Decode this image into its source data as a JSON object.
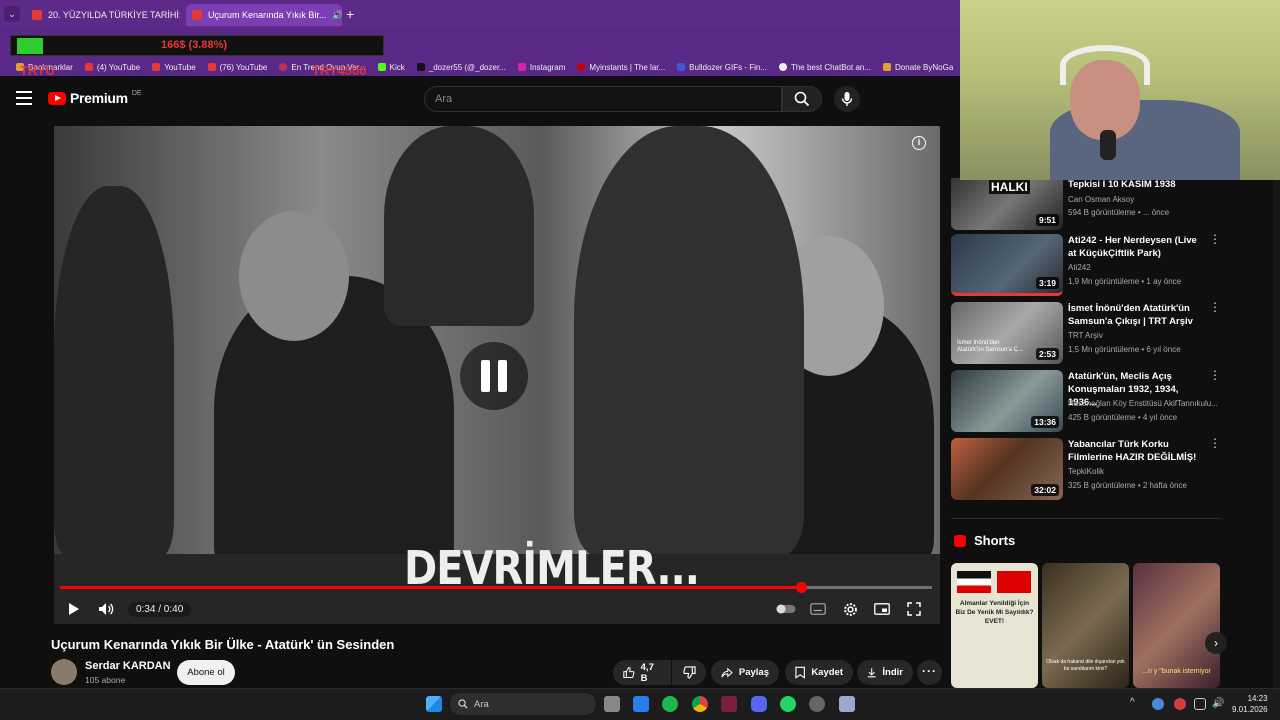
{
  "browser": {
    "tabs": [
      {
        "label": "20. YÜZYILDA TÜRKİYE TARİHİ: ..."
      },
      {
        "label": "Uçurum Kenarında Yıkık Bir..."
      }
    ],
    "overlay_text": "166$ (3.88%)",
    "red_tags": [
      "TRYU",
      "TRY4500"
    ],
    "bookmarks": [
      "Bookmarklar",
      "(4) YouTube",
      "YouTube",
      "(76) YouTube",
      "En Trend Oyun Ver...",
      "Kick",
      "_dozer55 (@_dozer...",
      "Instagram",
      "Myinstants | The lar...",
      "Bulldozer GIFs - Fin...",
      "The best ChatBot an...",
      "Donate ByNoGa"
    ]
  },
  "youtube": {
    "logo_text": "Premium",
    "logo_region": "DE",
    "search_placeholder": "Ara"
  },
  "player": {
    "caption": "DEVRİMLER...",
    "time": "0:34 / 0:40",
    "progress_fraction": 0.85,
    "state": "paused-indicator"
  },
  "video": {
    "title": "Uçurum Kenarında Yıkık Bir Ülke - Atatürk' ün Sesinden",
    "channel": "Serdar KARDAN",
    "subscribers": "105 abone",
    "subscribe_label": "Abone ol",
    "likes": "4,7 B",
    "share_label": "Paylaş",
    "save_label": "Kaydet",
    "download_label": "İndir"
  },
  "recommendations": [
    {
      "title": "Tepkisi I 10 KASIM 1938",
      "channel": "Can Osman Aksoy",
      "meta": "594 B görüntüleme • ... önce",
      "duration": "9:51",
      "thumb_label": "HALKI"
    },
    {
      "title": "Ati242 - Her Nerdeysen (Live at KüçükÇiftlik Park)",
      "channel": "Ati242",
      "meta": "1,9 Mn görüntüleme • 1 ay önce",
      "duration": "3:19",
      "thumb_label": ""
    },
    {
      "title": "İsmet İnönü'den Atatürk'ün Samsun'a Çıkışı | TRT Arşiv",
      "channel": "TRT Arşiv",
      "meta": "1,5 Mn görüntüleme • 6 yıl önce",
      "duration": "2:53",
      "thumb_label": "İsmet İnönü'den Atatürk'ün Samsun'a Ç..."
    },
    {
      "title": "Atatürk'ün, Meclis Açış Konuşmaları 1932, 1934, 1936...",
      "channel": "Hasanoğlan Köy Enstitüsü AkifTannıkulu...",
      "meta": "425 B görüntüleme • 4 yıl önce",
      "duration": "13:36",
      "thumb_label": ""
    },
    {
      "title": "Yabancılar Türk Korku Filmlerine HAZIR DEĞİLMİŞ!",
      "channel": "TepkiKolik",
      "meta": "325 B görüntüleme • 2 hafta önce",
      "duration": "32:02",
      "thumb_label": ""
    }
  ],
  "shorts": {
    "heading": "Shorts",
    "items": [
      {
        "caption": "Almanlar Yenildiği İçin Biz De Yenik Mi Sayıldık? EVET!"
      },
      {
        "caption": "Olsak da hakarat dile dışarıdan yok bu sandılarım kimi?"
      },
      {
        "caption": "...n y \"bunak istemiyor"
      }
    ]
  },
  "taskbar": {
    "search_placeholder": "Ara",
    "time": "14:23",
    "date": "9.01.2026"
  },
  "colors": {
    "accent_red": "#ff0000",
    "browser_purple": "#5d2a8a",
    "yt_background": "#0f0f0f"
  }
}
